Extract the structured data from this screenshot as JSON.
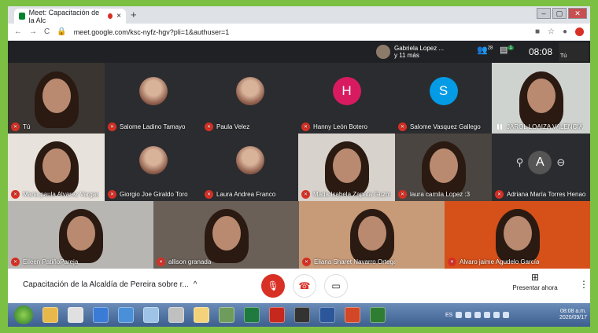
{
  "browser": {
    "tab_title": "Meet: Capacitación de la Alc",
    "new_tab": "+",
    "url": "meet.google.com/ksc-nyfz-hgv?pli=1&authuser=1",
    "window_buttons": [
      "–",
      "▢",
      "✕"
    ]
  },
  "topbar": {
    "presenter_name": "Gabriela Lopez ...",
    "presenter_more": "y 11 más",
    "participants_count": "28",
    "chat_count": "1",
    "clock": "08:08",
    "self_label": "Tú"
  },
  "tiles": [
    {
      "name": "Tú",
      "muted": true,
      "kind": "video"
    },
    {
      "name": "Salome Ladino Tamayo",
      "muted": true,
      "kind": "photo"
    },
    {
      "name": "Paula Velez",
      "muted": true,
      "kind": "photo"
    },
    {
      "name": "Hanny León Botero",
      "muted": true,
      "kind": "letter",
      "letter": "H",
      "color": "#d81b60"
    },
    {
      "name": "Salome Vasquez Gallego",
      "muted": true,
      "kind": "letter",
      "letter": "S",
      "color": "#039be5"
    },
    {
      "name": "JAROL LOAIZA VALENCIA",
      "muted": false,
      "kind": "video"
    },
    {
      "name": "Maria paula Alvarez Vargas",
      "muted": true,
      "kind": "video"
    },
    {
      "name": "Giorgio Joe Giraldo Toro",
      "muted": true,
      "kind": "photo"
    },
    {
      "name": "Laura Andrea Franco",
      "muted": true,
      "kind": "photo"
    },
    {
      "name": "Maria Isabela Zapata Guzm",
      "muted": true,
      "kind": "video"
    },
    {
      "name": "laura camila Lopez :3",
      "muted": true,
      "kind": "video"
    },
    {
      "name": "Adriana María Torres Henao",
      "muted": true,
      "kind": "hover",
      "letter": "A"
    },
    {
      "name": "Eileen PatiñoPareja",
      "muted": true,
      "kind": "video"
    },
    {
      "name": "allison granada",
      "muted": true,
      "kind": "video"
    },
    {
      "name": "Eliana Sharet Navarro Ortega",
      "muted": true,
      "kind": "video"
    },
    {
      "name": "Alvaro jaime Agudelo García",
      "muted": true,
      "kind": "video"
    }
  ],
  "bottombar": {
    "meeting_title": "Capacitación de la Alcaldía de Pereira sobre r...",
    "chevron": "^",
    "present_label": "Presentar ahora",
    "more": "⋮"
  },
  "taskbar": {
    "lang": "ES",
    "time": "08:08 a.m.",
    "date": "2020/09/17"
  },
  "colors": {
    "meet_bg": "#202124",
    "mute_red": "#d93025",
    "border_green": "#7cc043"
  }
}
